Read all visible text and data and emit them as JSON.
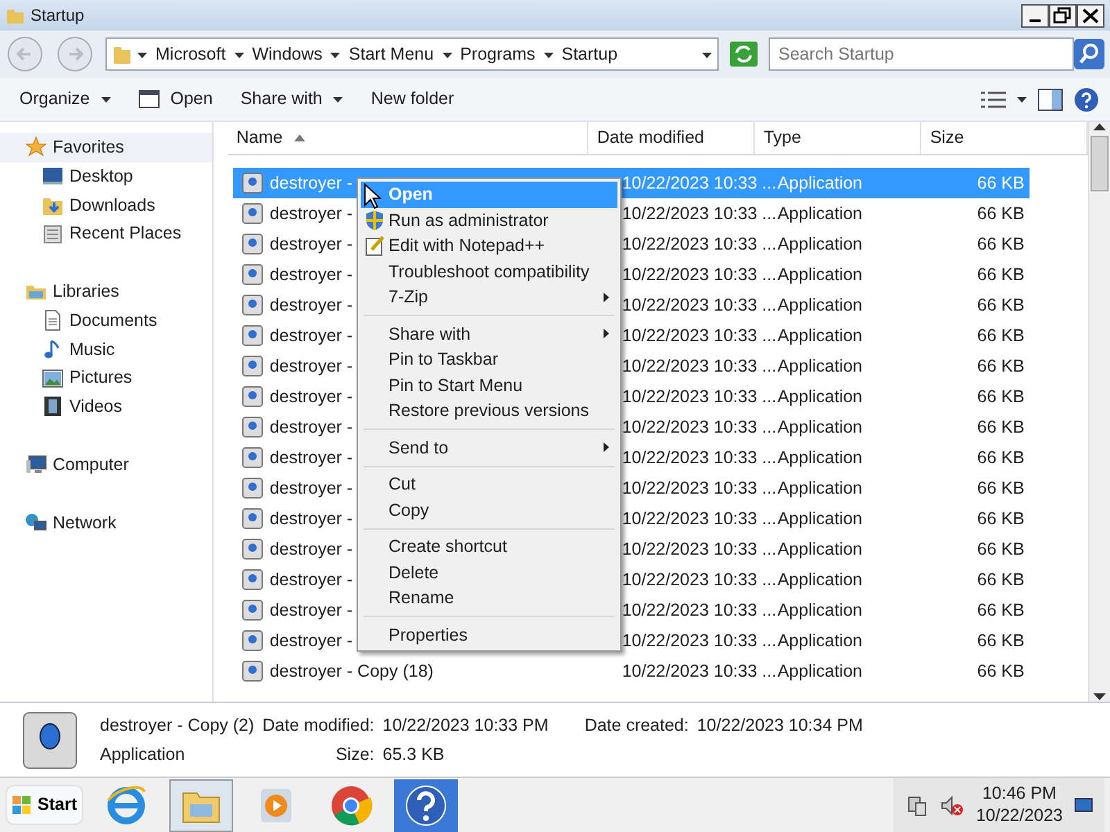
{
  "window": {
    "title": "Startup"
  },
  "address": {
    "crumbs": [
      "Microsoft",
      "Windows",
      "Start Menu",
      "Programs",
      "Startup"
    ]
  },
  "search": {
    "placeholder": "Search Startup"
  },
  "toolbar": [
    {
      "label": "Organize",
      "dropdown": true,
      "kind": "menu"
    },
    {
      "label": "Open",
      "dropdown": false,
      "kind": "open"
    },
    {
      "label": "Share with",
      "dropdown": true,
      "kind": "menu"
    },
    {
      "label": "New folder",
      "dropdown": false,
      "kind": "menu"
    }
  ],
  "sidebar": [
    {
      "label": "Favorites",
      "kind": "star",
      "selected": true,
      "children": [
        {
          "label": "Desktop",
          "kind": "desktop"
        },
        {
          "label": "Downloads",
          "kind": "downloads"
        },
        {
          "label": "Recent Places",
          "kind": "recent"
        }
      ]
    },
    {
      "label": "Libraries",
      "kind": "libraries",
      "selected": false,
      "children": [
        {
          "label": "Documents",
          "kind": "documents"
        },
        {
          "label": "Music",
          "kind": "music"
        },
        {
          "label": "Pictures",
          "kind": "pictures"
        },
        {
          "label": "Videos",
          "kind": "videos"
        }
      ]
    },
    {
      "label": "Computer",
      "kind": "computer",
      "selected": false
    },
    {
      "label": "Network",
      "kind": "network",
      "selected": false
    }
  ],
  "table": {
    "columns": [
      {
        "label": "Name",
        "sorted": true
      },
      {
        "label": "Date modified",
        "sorted": false
      },
      {
        "label": "Type",
        "sorted": false
      },
      {
        "label": "Size",
        "sorted": false
      }
    ],
    "rows": [
      {
        "name": "destroyer -",
        "date": "10/22/2023 10:33 ...",
        "type": "Application",
        "size": "66 KB",
        "selected": true
      },
      {
        "name": "destroyer -",
        "date": "10/22/2023 10:33 ...",
        "type": "Application",
        "size": "66 KB",
        "selected": false
      },
      {
        "name": "destroyer -",
        "date": "10/22/2023 10:33 ...",
        "type": "Application",
        "size": "66 KB",
        "selected": false
      },
      {
        "name": "destroyer -",
        "date": "10/22/2023 10:33 ...",
        "type": "Application",
        "size": "66 KB",
        "selected": false
      },
      {
        "name": "destroyer -",
        "date": "10/22/2023 10:33 ...",
        "type": "Application",
        "size": "66 KB",
        "selected": false
      },
      {
        "name": "destroyer -",
        "date": "10/22/2023 10:33 ...",
        "type": "Application",
        "size": "66 KB",
        "selected": false
      },
      {
        "name": "destroyer -",
        "date": "10/22/2023 10:33 ...",
        "type": "Application",
        "size": "66 KB",
        "selected": false
      },
      {
        "name": "destroyer -",
        "date": "10/22/2023 10:33 ...",
        "type": "Application",
        "size": "66 KB",
        "selected": false
      },
      {
        "name": "destroyer -",
        "date": "10/22/2023 10:33 ...",
        "type": "Application",
        "size": "66 KB",
        "selected": false
      },
      {
        "name": "destroyer -",
        "date": "10/22/2023 10:33 ...",
        "type": "Application",
        "size": "66 KB",
        "selected": false
      },
      {
        "name": "destroyer -",
        "date": "10/22/2023 10:33 ...",
        "type": "Application",
        "size": "66 KB",
        "selected": false
      },
      {
        "name": "destroyer -",
        "date": "10/22/2023 10:33 ...",
        "type": "Application",
        "size": "66 KB",
        "selected": false
      },
      {
        "name": "destroyer -",
        "date": "10/22/2023 10:33 ...",
        "type": "Application",
        "size": "66 KB",
        "selected": false
      },
      {
        "name": "destroyer -",
        "date": "10/22/2023 10:33 ...",
        "type": "Application",
        "size": "66 KB",
        "selected": false
      },
      {
        "name": "destroyer -",
        "date": "10/22/2023 10:33 ...",
        "type": "Application",
        "size": "66 KB",
        "selected": false
      },
      {
        "name": "destroyer -",
        "date": "10/22/2023 10:33 ...",
        "type": "Application",
        "size": "66 KB",
        "selected": false
      },
      {
        "name": "destroyer - Copy (18)",
        "date": "10/22/2023 10:33 ...",
        "type": "Application",
        "size": "66 KB",
        "selected": false
      }
    ]
  },
  "context_menu": [
    [
      {
        "label": "Open",
        "bold": true,
        "selected": true,
        "submenu": false,
        "kind": "plain"
      },
      {
        "label": "Run as administrator",
        "bold": false,
        "selected": false,
        "submenu": false,
        "kind": "shield"
      },
      {
        "label": "Edit with Notepad++",
        "bold": false,
        "selected": false,
        "submenu": false,
        "kind": "notepad"
      },
      {
        "label": "Troubleshoot compatibility",
        "bold": false,
        "selected": false,
        "submenu": false,
        "kind": "plain"
      },
      {
        "label": "7-Zip",
        "bold": false,
        "selected": false,
        "submenu": true,
        "kind": "plain"
      }
    ],
    [
      {
        "label": "Share with",
        "bold": false,
        "selected": false,
        "submenu": true,
        "kind": "plain"
      },
      {
        "label": "Pin to Taskbar",
        "bold": false,
        "selected": false,
        "submenu": false,
        "kind": "plain"
      },
      {
        "label": "Pin to Start Menu",
        "bold": false,
        "selected": false,
        "submenu": false,
        "kind": "plain"
      },
      {
        "label": "Restore previous versions",
        "bold": false,
        "selected": false,
        "submenu": false,
        "kind": "plain"
      }
    ],
    [
      {
        "label": "Send to",
        "bold": false,
        "selected": false,
        "submenu": true,
        "kind": "plain"
      }
    ],
    [
      {
        "label": "Cut",
        "bold": false,
        "selected": false,
        "submenu": false,
        "kind": "plain"
      },
      {
        "label": "Copy",
        "bold": false,
        "selected": false,
        "submenu": false,
        "kind": "plain"
      }
    ],
    [
      {
        "label": "Create shortcut",
        "bold": false,
        "selected": false,
        "submenu": false,
        "kind": "plain"
      },
      {
        "label": "Delete",
        "bold": false,
        "selected": false,
        "submenu": false,
        "kind": "plain"
      },
      {
        "label": "Rename",
        "bold": false,
        "selected": false,
        "submenu": false,
        "kind": "plain"
      }
    ],
    [
      {
        "label": "Properties",
        "bold": false,
        "selected": false,
        "submenu": false,
        "kind": "plain"
      }
    ]
  ],
  "details": {
    "name": "destroyer - Copy (2)",
    "type": "Application",
    "modified_label": "Date modified:",
    "modified": "10/22/2023 10:33 PM",
    "created_label": "Date created:",
    "created": "10/22/2023 10:34 PM",
    "size_label": "Size:",
    "size": "65.3 KB"
  },
  "taskbar": {
    "start": "Start",
    "apps": [
      {
        "kind": "ie",
        "selected": false
      },
      {
        "kind": "explorer",
        "selected": true
      },
      {
        "kind": "media",
        "selected": false
      },
      {
        "kind": "chrome",
        "selected": false
      },
      {
        "kind": "help",
        "selected": false
      }
    ],
    "time": "10:46 PM",
    "date": "10/22/2023"
  }
}
